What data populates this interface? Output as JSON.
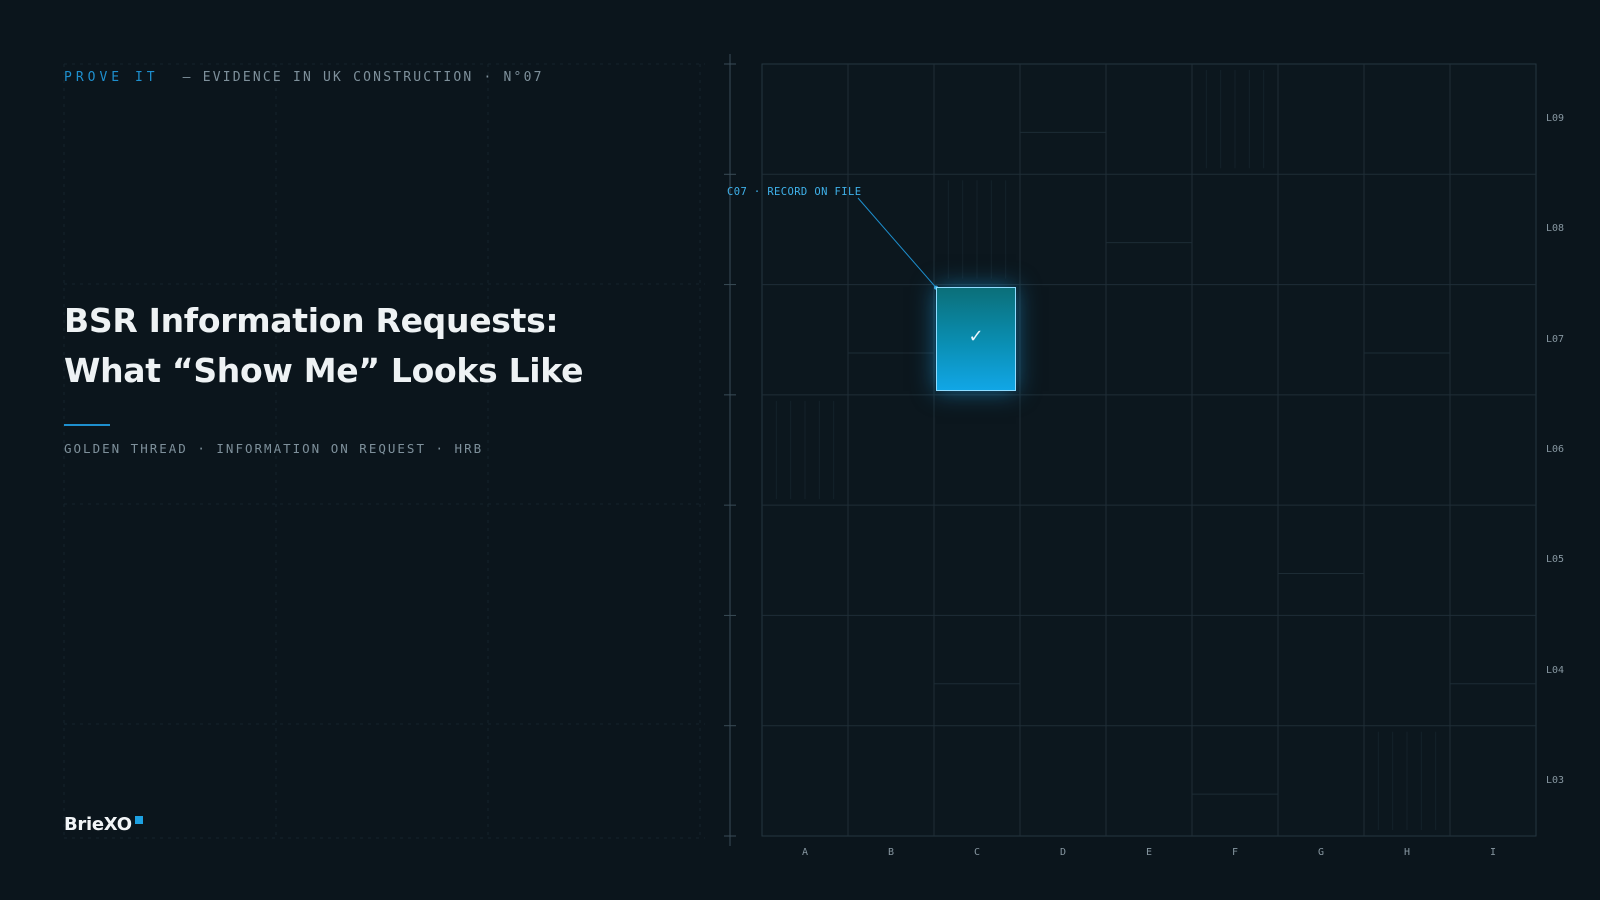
{
  "header": {
    "series": "PROVE IT",
    "subtitle": "— EVIDENCE IN UK CONSTRUCTION · N°07"
  },
  "title": {
    "line1": "BSR Information Requests:",
    "line2": "What “Show Me” Looks Like"
  },
  "tags": "GOLDEN THREAD · INFORMATION ON REQUEST · HRB",
  "brand": "BrieXO",
  "grid": {
    "columns": [
      "A",
      "B",
      "C",
      "D",
      "E",
      "F",
      "G",
      "H",
      "I"
    ],
    "rows": [
      "L09",
      "L08",
      "L07",
      "L06",
      "L05",
      "L04",
      "L03"
    ],
    "highlight": {
      "column": "C",
      "row": "L07"
    },
    "callout": "C07 · RECORD ON FILE",
    "check_icon": "checkmark-icon"
  },
  "colors": {
    "background": "#0b151c",
    "accent": "#1e8fce",
    "highlight_top": "#0b6f79",
    "highlight_bottom": "#11a6e6",
    "grid_line": "#1f2e37"
  }
}
